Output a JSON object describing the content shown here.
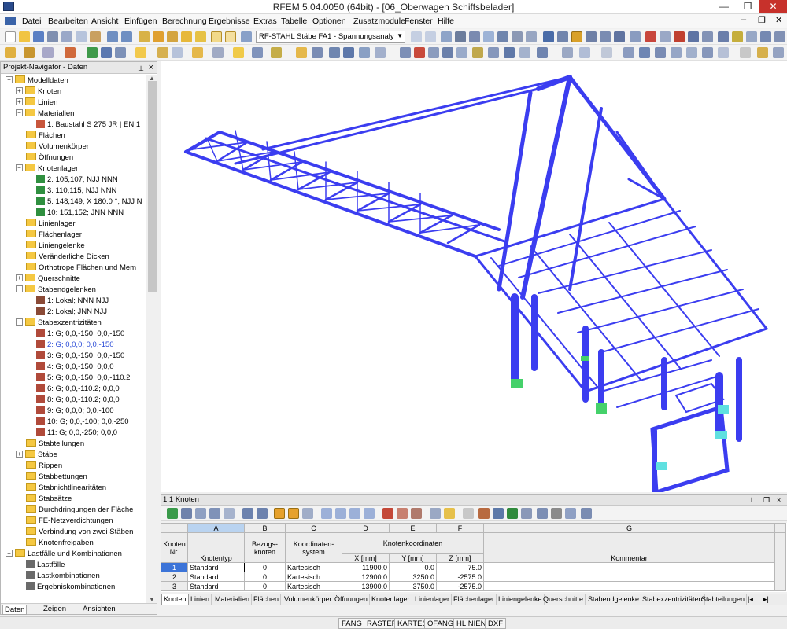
{
  "window": {
    "title": "RFEM 5.04.0050 (64bit) - [06_Oberwagen Schiffsbelader]",
    "min": "—",
    "max": "❐",
    "close": "✕"
  },
  "menu": [
    "Datei",
    "Bearbeiten",
    "Ansicht",
    "Einfügen",
    "Berechnung",
    "Ergebnisse",
    "Extras",
    "Tabelle",
    "Optionen",
    "Zusatzmodule",
    "Fenster",
    "Hilfe"
  ],
  "mdi_controls": {
    "min": "–",
    "restore": "❐",
    "close": "✕"
  },
  "toolbar": {
    "module_combo": "RF-STAHL Stäbe FA1 - Spannungsanaly"
  },
  "navigator": {
    "title": "Projekt-Navigator - Daten",
    "tree": [
      {
        "label": "Modelldaten",
        "level": 0,
        "type": "folder",
        "expander": "−"
      },
      {
        "label": "Knoten",
        "level": 1,
        "type": "folder",
        "expander": "+"
      },
      {
        "label": "Linien",
        "level": 1,
        "type": "folder",
        "expander": "+"
      },
      {
        "label": "Materialien",
        "level": 1,
        "type": "folder",
        "expander": "−"
      },
      {
        "label": "1: Baustahl S 275 JR | EN 1",
        "level": 2,
        "type": "material"
      },
      {
        "label": "Flächen",
        "level": 1,
        "type": "folder"
      },
      {
        "label": "Volumenkörper",
        "level": 1,
        "type": "folder"
      },
      {
        "label": "Öffnungen",
        "level": 1,
        "type": "folder"
      },
      {
        "label": "Knotenlager",
        "level": 1,
        "type": "folder",
        "expander": "−"
      },
      {
        "label": "2: 105,107; NJJ NNN",
        "level": 2,
        "type": "support"
      },
      {
        "label": "3: 110,115; NJJ NNN",
        "level": 2,
        "type": "support"
      },
      {
        "label": "5: 148,149; X 180.0 °; NJJ N",
        "level": 2,
        "type": "support"
      },
      {
        "label": "10: 151,152; JNN NNN",
        "level": 2,
        "type": "support"
      },
      {
        "label": "Linienlager",
        "level": 1,
        "type": "folder"
      },
      {
        "label": "Flächenlager",
        "level": 1,
        "type": "folder"
      },
      {
        "label": "Liniengelenke",
        "level": 1,
        "type": "folder"
      },
      {
        "label": "Veränderliche Dicken",
        "level": 1,
        "type": "folder"
      },
      {
        "label": "Orthotrope Flächen und Mem",
        "level": 1,
        "type": "folder"
      },
      {
        "label": "Querschnitte",
        "level": 1,
        "type": "folder",
        "expander": "+"
      },
      {
        "label": "Stabendgelenken",
        "level": 1,
        "type": "folder",
        "expander": "−"
      },
      {
        "label": "1: Lokal; NNN NJJ",
        "level": 2,
        "type": "hinge"
      },
      {
        "label": "2: Lokal; JNN NJJ",
        "level": 2,
        "type": "hinge"
      },
      {
        "label": "Stabexzentrizitäten",
        "level": 1,
        "type": "folder",
        "expander": "−"
      },
      {
        "label": "1: G; 0,0,-150; 0,0,-150",
        "level": 2,
        "type": "ecc"
      },
      {
        "label": "2: G; 0,0,0; 0,0,-150",
        "level": 2,
        "type": "ecc",
        "selected": true
      },
      {
        "label": "3: G; 0,0,-150; 0,0,-150",
        "level": 2,
        "type": "ecc"
      },
      {
        "label": "4: G; 0,0,-150; 0,0,0",
        "level": 2,
        "type": "ecc"
      },
      {
        "label": "5: G; 0,0,-150; 0,0,-110.2",
        "level": 2,
        "type": "ecc"
      },
      {
        "label": "6: G; 0,0,-110.2; 0,0,0",
        "level": 2,
        "type": "ecc"
      },
      {
        "label": "8: G; 0,0,-110.2; 0,0,0",
        "level": 2,
        "type": "ecc"
      },
      {
        "label": "9: G; 0,0,0; 0,0,-100",
        "level": 2,
        "type": "ecc"
      },
      {
        "label": "10: G; 0,0,-100; 0,0,-250",
        "level": 2,
        "type": "ecc"
      },
      {
        "label": "11: G; 0,0,-250; 0,0,0",
        "level": 2,
        "type": "ecc"
      },
      {
        "label": "Stabteilungen",
        "level": 1,
        "type": "folder"
      },
      {
        "label": "Stäbe",
        "level": 1,
        "type": "folder",
        "expander": "+"
      },
      {
        "label": "Rippen",
        "level": 1,
        "type": "folder"
      },
      {
        "label": "Stabbettungen",
        "level": 1,
        "type": "folder"
      },
      {
        "label": "Stabnichtlinearitäten",
        "level": 1,
        "type": "folder"
      },
      {
        "label": "Stabsätze",
        "level": 1,
        "type": "folder"
      },
      {
        "label": "Durchdringungen der Fläche",
        "level": 1,
        "type": "folder"
      },
      {
        "label": "FE-Netzverdichtungen",
        "level": 1,
        "type": "folder"
      },
      {
        "label": "Verbindung von zwei Stäben",
        "level": 1,
        "type": "folder"
      },
      {
        "label": "Knotenfreigaben",
        "level": 1,
        "type": "folder"
      },
      {
        "label": "Lastfälle und Kombinationen",
        "level": 0,
        "type": "folder",
        "expander": "−"
      },
      {
        "label": "Lastfälle",
        "level": 1,
        "type": "loadcase"
      },
      {
        "label": "Lastkombinationen",
        "level": 1,
        "type": "loadcase"
      },
      {
        "label": "Ergebniskombinationen",
        "level": 1,
        "type": "loadcase"
      }
    ],
    "tabs": [
      "Daten",
      "Zeigen",
      "Ansichten"
    ]
  },
  "panel": {
    "title": "1.1 Knoten",
    "columns": [
      "A",
      "B",
      "C",
      "D",
      "E",
      "F",
      "G"
    ],
    "header": {
      "knoten_nr": "Knoten Nr.",
      "knotentyp": "Knotentyp",
      "bezugsknoten": "Bezugs-knoten",
      "koordinatensystem": "Koordinaten-system",
      "knotenkoordinaten": "Knotenkoordinaten",
      "x": "X [mm]",
      "y": "Y [mm]",
      "z": "Z [mm]",
      "kommentar": "Kommentar"
    },
    "rows": [
      {
        "nr": "1",
        "typ": "Standard",
        "bezug": "0",
        "system": "Kartesisch",
        "x": "11900.0",
        "y": "0.0",
        "z": "75.0",
        "kommentar": ""
      },
      {
        "nr": "2",
        "typ": "Standard",
        "bezug": "0",
        "system": "Kartesisch",
        "x": "12900.0",
        "y": "3250.0",
        "z": "-2575.0",
        "kommentar": ""
      },
      {
        "nr": "3",
        "typ": "Standard",
        "bezug": "0",
        "system": "Kartesisch",
        "x": "13900.0",
        "y": "3750.0",
        "z": "-2575.0",
        "kommentar": ""
      }
    ],
    "tabs": [
      "Knoten",
      "Linien",
      "Materialien",
      "Flächen",
      "Volumenkörper",
      "Öffnungen",
      "Knotenlager",
      "Linienlager",
      "Flächenlager",
      "Liniengelenke",
      "Querschnitte",
      "Stabendgelenke",
      "Stabexzentrizitäten",
      "Stabteilungen"
    ]
  },
  "statusbar": [
    "FANG",
    "RASTER",
    "KARTES",
    "OFANG",
    "HLINIEN",
    "DXF"
  ],
  "colors": {
    "structure": "#3b3df0",
    "support_green": "#45d16a",
    "support_cyan": "#5fe0e0",
    "selection": "#3c74d8"
  }
}
